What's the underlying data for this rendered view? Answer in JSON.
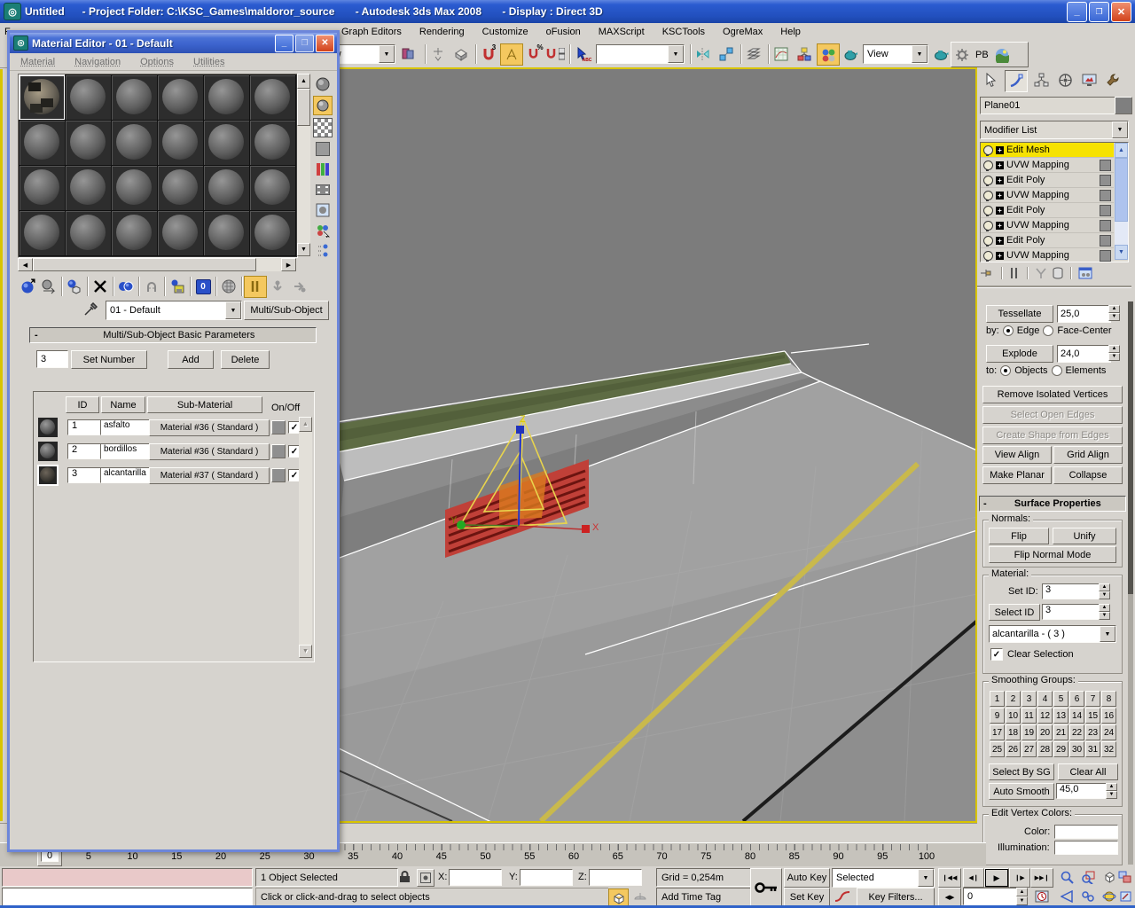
{
  "window": {
    "title": "Untitled      - Project Folder: C:\\KSC_Games\\maldoror_source       - Autodesk 3ds Max 2008       - Display : Direct 3D"
  },
  "icons": {
    "dd": "▼",
    "up": "▲",
    "down": "▼",
    "left": "◀",
    "right": "▶",
    "check": "✓",
    "plus": "+",
    "minus": "-",
    "close": "✕",
    "play": "▶",
    "prev": "◀",
    "next": "▶",
    "bar": "❙",
    "abc": "ABC",
    "fov": "▷"
  },
  "menu": {
    "file_partial": "F",
    "items": [
      "Graph Editors",
      "Rendering",
      "Customize",
      "oFusion",
      "MAXScript",
      "KSCTools",
      "OgreMax",
      "Help"
    ]
  },
  "toolbar": {
    "ref_coordsys_value": "View",
    "named_selection_value": "",
    "render_view_value": "View",
    "pb_label": "PB",
    "snap3_superscript": "3",
    "snap_percent": "%"
  },
  "material_editor": {
    "title": "Material Editor - 01 - Default",
    "menus": [
      "Material",
      "Navigation",
      "Options",
      "Utilities"
    ],
    "slots": [
      {
        "sel": true,
        "tex": true
      },
      {},
      {},
      {},
      {},
      {},
      {},
      {},
      {},
      {},
      {},
      {},
      {},
      {},
      {},
      {},
      {},
      {},
      {},
      {},
      {},
      {},
      {},
      {}
    ],
    "material_name": "01 - Default",
    "type_button": "Multi/Sub-Object",
    "rollout_title": "Multi/Sub-Object Basic Parameters",
    "count_value": "3",
    "set_number_label": "Set Number",
    "add_label": "Add",
    "delete_label": "Delete",
    "table": {
      "id_header": "ID",
      "name_header": "Name",
      "sub_header": "Sub-Material",
      "onoff_label": "On/Off",
      "rows": [
        {
          "id": "1",
          "name": "asfalto",
          "sub": "Material #36  ( Standard )",
          "on": true,
          "psel": false,
          "tex": false
        },
        {
          "id": "2",
          "name": "bordillos",
          "sub": "Material #36  ( Standard )",
          "on": true,
          "psel": false,
          "tex": false
        },
        {
          "id": "3",
          "name": "alcantarilla",
          "sub": "Material #37  ( Standard )",
          "on": true,
          "psel": true,
          "tex": true
        }
      ]
    }
  },
  "command_panel": {
    "object_name": "Plane01",
    "modifier_list_label": "Modifier List",
    "stack": [
      {
        "label": "Edit Mesh",
        "selected": true,
        "swatch": false
      },
      {
        "label": "UVW Mapping",
        "swatch": true
      },
      {
        "label": "Edit Poly",
        "swatch": true
      },
      {
        "label": "UVW Mapping",
        "swatch": true
      },
      {
        "label": "Edit Poly",
        "swatch": true
      },
      {
        "label": "UVW Mapping",
        "swatch": true
      },
      {
        "label": "Edit Poly",
        "swatch": true
      },
      {
        "label": "UVW Mapping",
        "swatch": true
      }
    ],
    "edit_geometry": {
      "tessellate": "Tessellate",
      "tessellate_value": "25,0",
      "by_label": "by:",
      "edge": "Edge",
      "face_center": "Face-Center",
      "explode": "Explode",
      "explode_value": "24,0",
      "to_label": "to:",
      "objects": "Objects",
      "elements": "Elements",
      "remove_isolated": "Remove Isolated Vertices",
      "select_open_edges": "Select Open Edges",
      "create_shape": "Create Shape from Edges",
      "view_align": "View Align",
      "grid_align": "Grid Align",
      "make_planar": "Make Planar",
      "collapse": "Collapse"
    },
    "surface_properties": {
      "title": "Surface Properties",
      "normals_label": "Normals:",
      "flip": "Flip",
      "unify": "Unify",
      "flip_normal_mode": "Flip Normal Mode",
      "material_label": "Material:",
      "set_id_label": "Set ID:",
      "set_id_value": "3",
      "select_id": "Select ID",
      "select_id_value": "3",
      "material_dropdown_value": "alcantarilla - ( 3 )",
      "clear_selection": "Clear Selection",
      "clear_selection_checked": true,
      "smoothing_label": "Smoothing Groups:",
      "groups": [
        "1",
        "2",
        "3",
        "4",
        "5",
        "6",
        "7",
        "8",
        "9",
        "10",
        "11",
        "12",
        "13",
        "14",
        "15",
        "16",
        "17",
        "18",
        "19",
        "20",
        "21",
        "22",
        "23",
        "24",
        "25",
        "26",
        "27",
        "28",
        "29",
        "30",
        "31",
        "32"
      ],
      "select_by_sg": "Select By SG",
      "clear_all": "Clear All",
      "auto_smooth": "Auto Smooth",
      "auto_smooth_value": "45,0",
      "edit_vertex_label": "Edit Vertex Colors:",
      "color_label": "Color:",
      "illumination_label": "Illumination:"
    }
  },
  "viewport": {
    "axis_x": "X",
    "axis_y": "Y",
    "axis_z": "Z"
  },
  "timeline": {
    "labels": [
      "0",
      "5",
      "10",
      "15",
      "20",
      "25",
      "30",
      "35",
      "40",
      "45",
      "50",
      "55",
      "60",
      "65",
      "70",
      "75",
      "80",
      "85",
      "90",
      "95",
      "100"
    ],
    "slider_value": "0"
  },
  "status": {
    "selection_text": "1 Object Selected",
    "prompt_text": "Click or click-and-drag to select objects",
    "x_label": "X:",
    "y_label": "Y:",
    "z_label": "Z:",
    "x_value": "",
    "y_value": "",
    "z_value": "",
    "grid_label": "Grid = 0,254m",
    "add_time_tag": "Add Time Tag",
    "auto_key": "Auto Key",
    "set_key": "Set Key",
    "selected_dropdown_value": "Selected",
    "key_filters": "Key Filters...",
    "frame_value": "0"
  }
}
